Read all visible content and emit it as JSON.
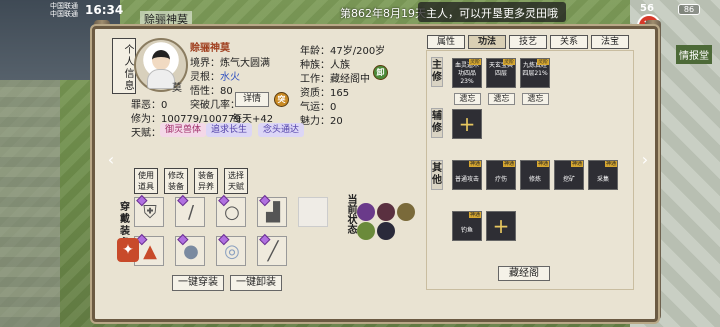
{
  "statusbar": {
    "carrier_1": "中国联通",
    "carrier_2": "中国联通",
    "time": "16:34",
    "net": "56",
    "battery": "86"
  },
  "top": {
    "player_name": "赊骊神莫",
    "date": "第862年8月19天",
    "prompt": "主人，可以开垦更多灵田哦",
    "right_tag": "情报堂"
  },
  "side_tab": "个人信息",
  "profile": {
    "name": "赊骊神莫",
    "avatar_char": "莫",
    "realm_label": "境界：",
    "realm_value": "炼气大圆满",
    "root_label": "灵根：",
    "root_value": "水火",
    "nature_label": "悟性：",
    "nature_value": "80",
    "sin_label": "罪恶：",
    "sin_value": "0",
    "breakthrough_label": "突破几率：",
    "details_button": "详情",
    "cultivation_label": "修为：",
    "cultivation_value": "100779/100779",
    "per_day_label": "每天+",
    "per_day_value": "42",
    "age_label": "年龄：",
    "age_value": "47岁/200岁",
    "race_label": "种族：",
    "race_value": "人族",
    "work_label": "工作：",
    "work_value": "藏经阁中",
    "aptitude_label": "资质：",
    "aptitude_value": "165",
    "qi_label": "气运：",
    "qi_value": "0",
    "charm_label": "魅力：",
    "charm_value": "20",
    "mark_1": "卸",
    "mark_2": "突"
  },
  "talents": {
    "label": "天赋：",
    "items": [
      "御灵兽体",
      "追求长生",
      "念头通达"
    ]
  },
  "mini_buttons": [
    "使用道具",
    "修改装备",
    "装备异养",
    "选择天赋"
  ],
  "equipment": {
    "label": "穿戴装备",
    "wear_all": "一键穿装",
    "remove_all": "一键卸装"
  },
  "current_state_label": "当前状态",
  "right_tabs": [
    "属性",
    "功法",
    "技艺",
    "关系",
    "法宝"
  ],
  "sections": {
    "main": "主修",
    "aux": "辅修",
    "other": "其他"
  },
  "main_skills": [
    {
      "tag": "灵阶",
      "name": "血灵遁术",
      "pct": "功四品 23%"
    },
    {
      "tag": "灵阶",
      "name": "天玄宝典",
      "pct": "四层"
    },
    {
      "tag": "灵阶",
      "name": "九炼真经",
      "pct": "四层21%"
    }
  ],
  "forget_button": "遗忘",
  "other_skills": [
    {
      "tag": "神通",
      "name": "普通攻击"
    },
    {
      "tag": "神通",
      "name": "疗伤"
    },
    {
      "tag": "神通",
      "name": "修炼"
    },
    {
      "tag": "神通",
      "name": "挖矿"
    },
    {
      "tag": "神通",
      "name": "采集"
    },
    {
      "tag": "神通",
      "name": "钓鱼"
    }
  ],
  "cangjing_button": "藏经阁",
  "colors": {
    "frame": "#6b5a42",
    "paper": "#e9e3d2",
    "skill_bg": "#2e2e34",
    "gem": "#b070e0",
    "close": "#d63a2a"
  }
}
